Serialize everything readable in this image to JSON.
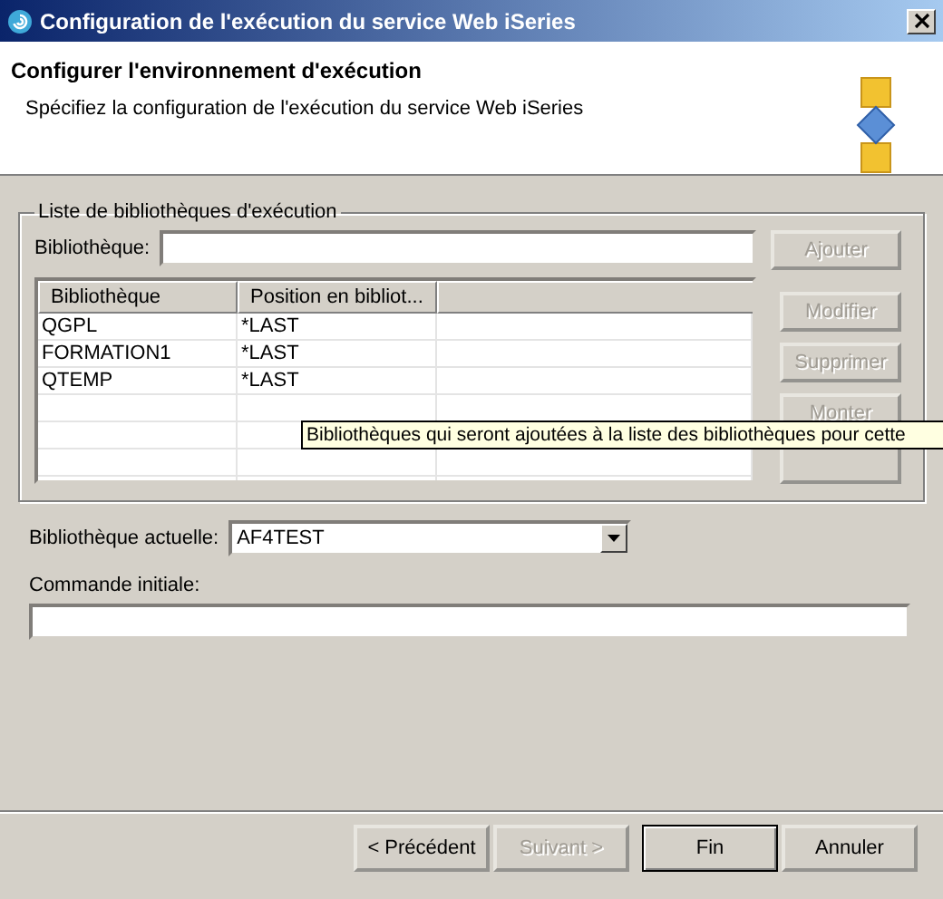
{
  "window": {
    "title": "Configuration de l'exécution du service Web iSeries"
  },
  "header": {
    "title": "Configurer l'environnement d'exécution",
    "description": "Spécifiez la configuration de l'exécution du service Web iSeries"
  },
  "group": {
    "title": "Liste de bibliothèques d'exécution",
    "library_label": "Bibliothèque:",
    "add_button": {
      "label": "Ajouter",
      "disabled": true
    },
    "table": {
      "columns": [
        "Bibliothèque",
        "Position en bibliot..."
      ],
      "rows": [
        [
          "QGPL",
          "*LAST"
        ],
        [
          "FORMATION1",
          "*LAST"
        ],
        [
          "QTEMP",
          "*LAST"
        ]
      ]
    },
    "side_buttons": [
      {
        "label": "Modifier",
        "disabled": true
      },
      {
        "label": "Supprimer",
        "disabled": true
      },
      {
        "label": "Monter",
        "disabled": true
      }
    ]
  },
  "tooltip": "Bibliothèques qui seront ajoutées à la liste des bibliothèques pour cette",
  "current_library": {
    "label": "Bibliothèque actuelle:",
    "value": "AF4TEST"
  },
  "initial_command": {
    "label": "Commande initiale:"
  },
  "buttons": [
    {
      "label": "< Précédent",
      "disabled": false,
      "default": false
    },
    {
      "label": "Suivant >",
      "disabled": true,
      "default": false
    },
    {
      "label": "Fin",
      "disabled": false,
      "default": true
    },
    {
      "label": "Annuler",
      "disabled": false,
      "default": false
    }
  ]
}
